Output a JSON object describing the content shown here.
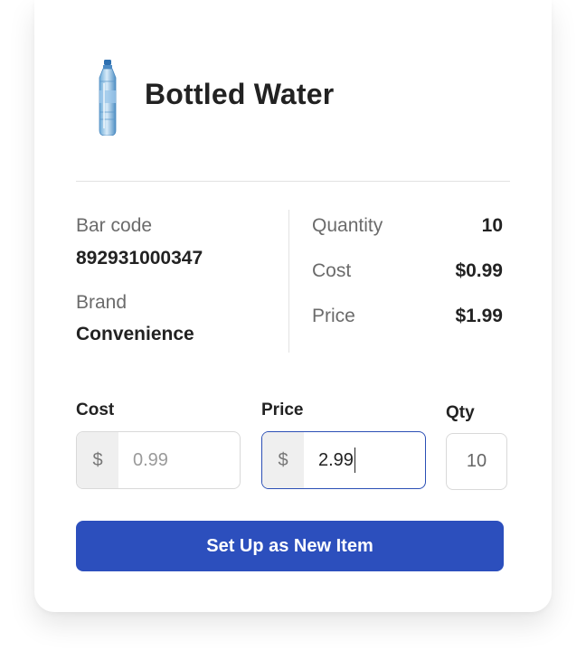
{
  "product": {
    "title": "Bottled Water",
    "image_icon": "water-bottle-image"
  },
  "details": {
    "barcode_label": "Bar code",
    "barcode_value": "892931000347",
    "brand_label": "Brand",
    "brand_value": "Convenience"
  },
  "stats": {
    "quantity_label": "Quantity",
    "quantity_value": "10",
    "cost_label": "Cost",
    "cost_value": "$0.99",
    "price_label": "Price",
    "price_value": "$1.99"
  },
  "form": {
    "cost_label": "Cost",
    "cost_prefix": "$",
    "cost_placeholder": "0.99",
    "price_label": "Price",
    "price_prefix": "$",
    "price_value": "2.99",
    "qty_label": "Qty",
    "qty_placeholder": "10"
  },
  "actions": {
    "setup_label": "Set Up as New Item"
  },
  "colors": {
    "primary": "#2c4fbd",
    "focus_border": "#2b4fb5",
    "text_dark": "#222222",
    "text_muted": "#6b6b6b"
  }
}
